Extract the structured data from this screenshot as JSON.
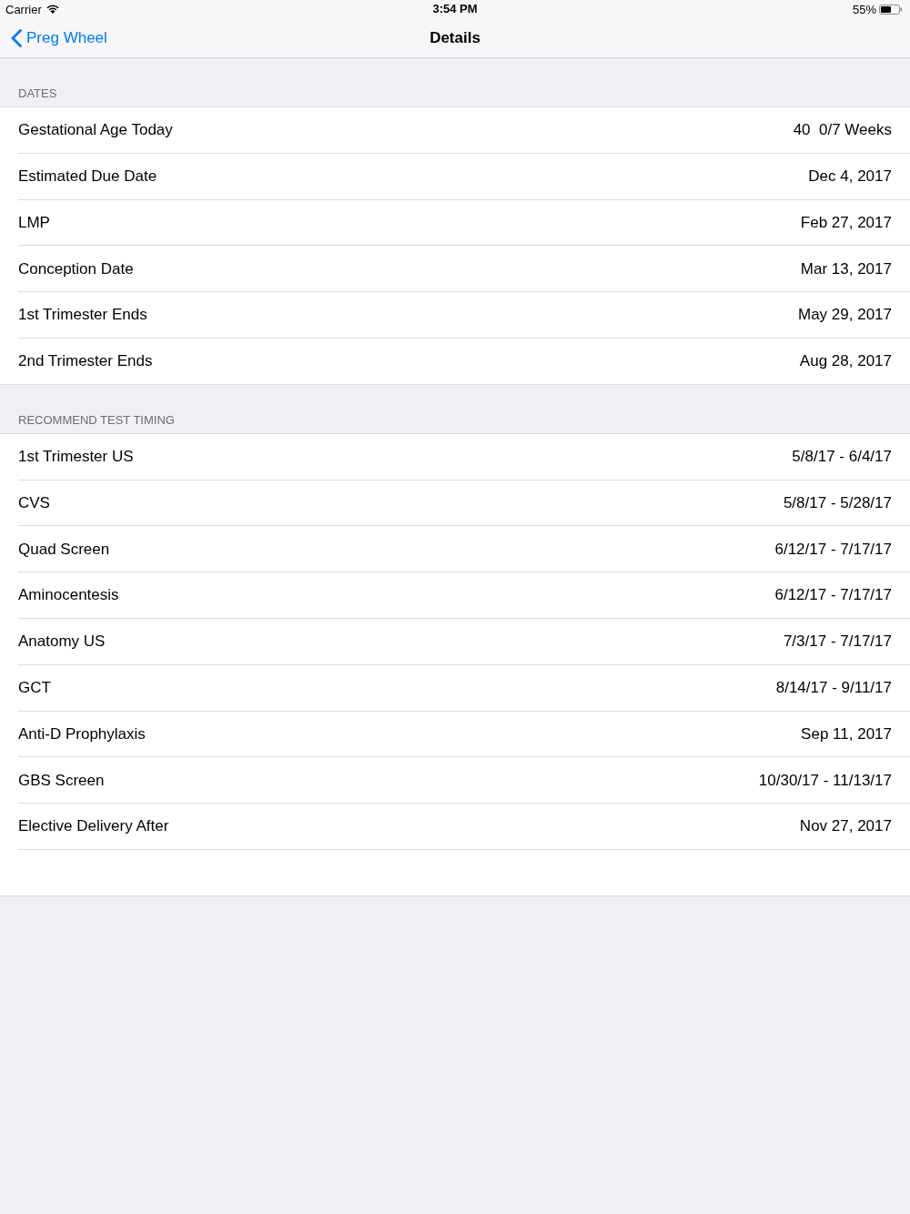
{
  "status_bar": {
    "carrier": "Carrier",
    "time": "3:54 PM",
    "battery": "55%"
  },
  "nav_bar": {
    "back_button": "Preg Wheel",
    "title": "Details"
  },
  "sections": [
    {
      "header": "DATES",
      "rows": [
        {
          "label": "Gestational Age Today",
          "value": "40  0/7 Weeks"
        },
        {
          "label": "Estimated Due Date",
          "value": "Dec 4, 2017"
        },
        {
          "label": "LMP",
          "value": "Feb 27, 2017"
        },
        {
          "label": "Conception Date",
          "value": "Mar 13, 2017"
        },
        {
          "label": "1st Trimester Ends",
          "value": "May 29, 2017"
        },
        {
          "label": "2nd Trimester Ends",
          "value": "Aug 28, 2017"
        }
      ]
    },
    {
      "header": "RECOMMEND TEST TIMING",
      "rows": [
        {
          "label": "1st Trimester US",
          "value": "5/8/17 - 6/4/17"
        },
        {
          "label": "CVS",
          "value": "5/8/17 - 5/28/17"
        },
        {
          "label": "Quad Screen",
          "value": "6/12/17 - 7/17/17"
        },
        {
          "label": "Aminocentesis",
          "value": "6/12/17 - 7/17/17"
        },
        {
          "label": "Anatomy US",
          "value": "7/3/17 - 7/17/17"
        },
        {
          "label": "GCT",
          "value": "8/14/17 - 9/11/17"
        },
        {
          "label": "Anti-D Prophylaxis",
          "value": "Sep 11, 2017"
        },
        {
          "label": "GBS Screen",
          "value": "10/30/17 - 11/13/17"
        },
        {
          "label": "Elective Delivery After",
          "value": "Nov 27, 2017"
        }
      ]
    }
  ]
}
